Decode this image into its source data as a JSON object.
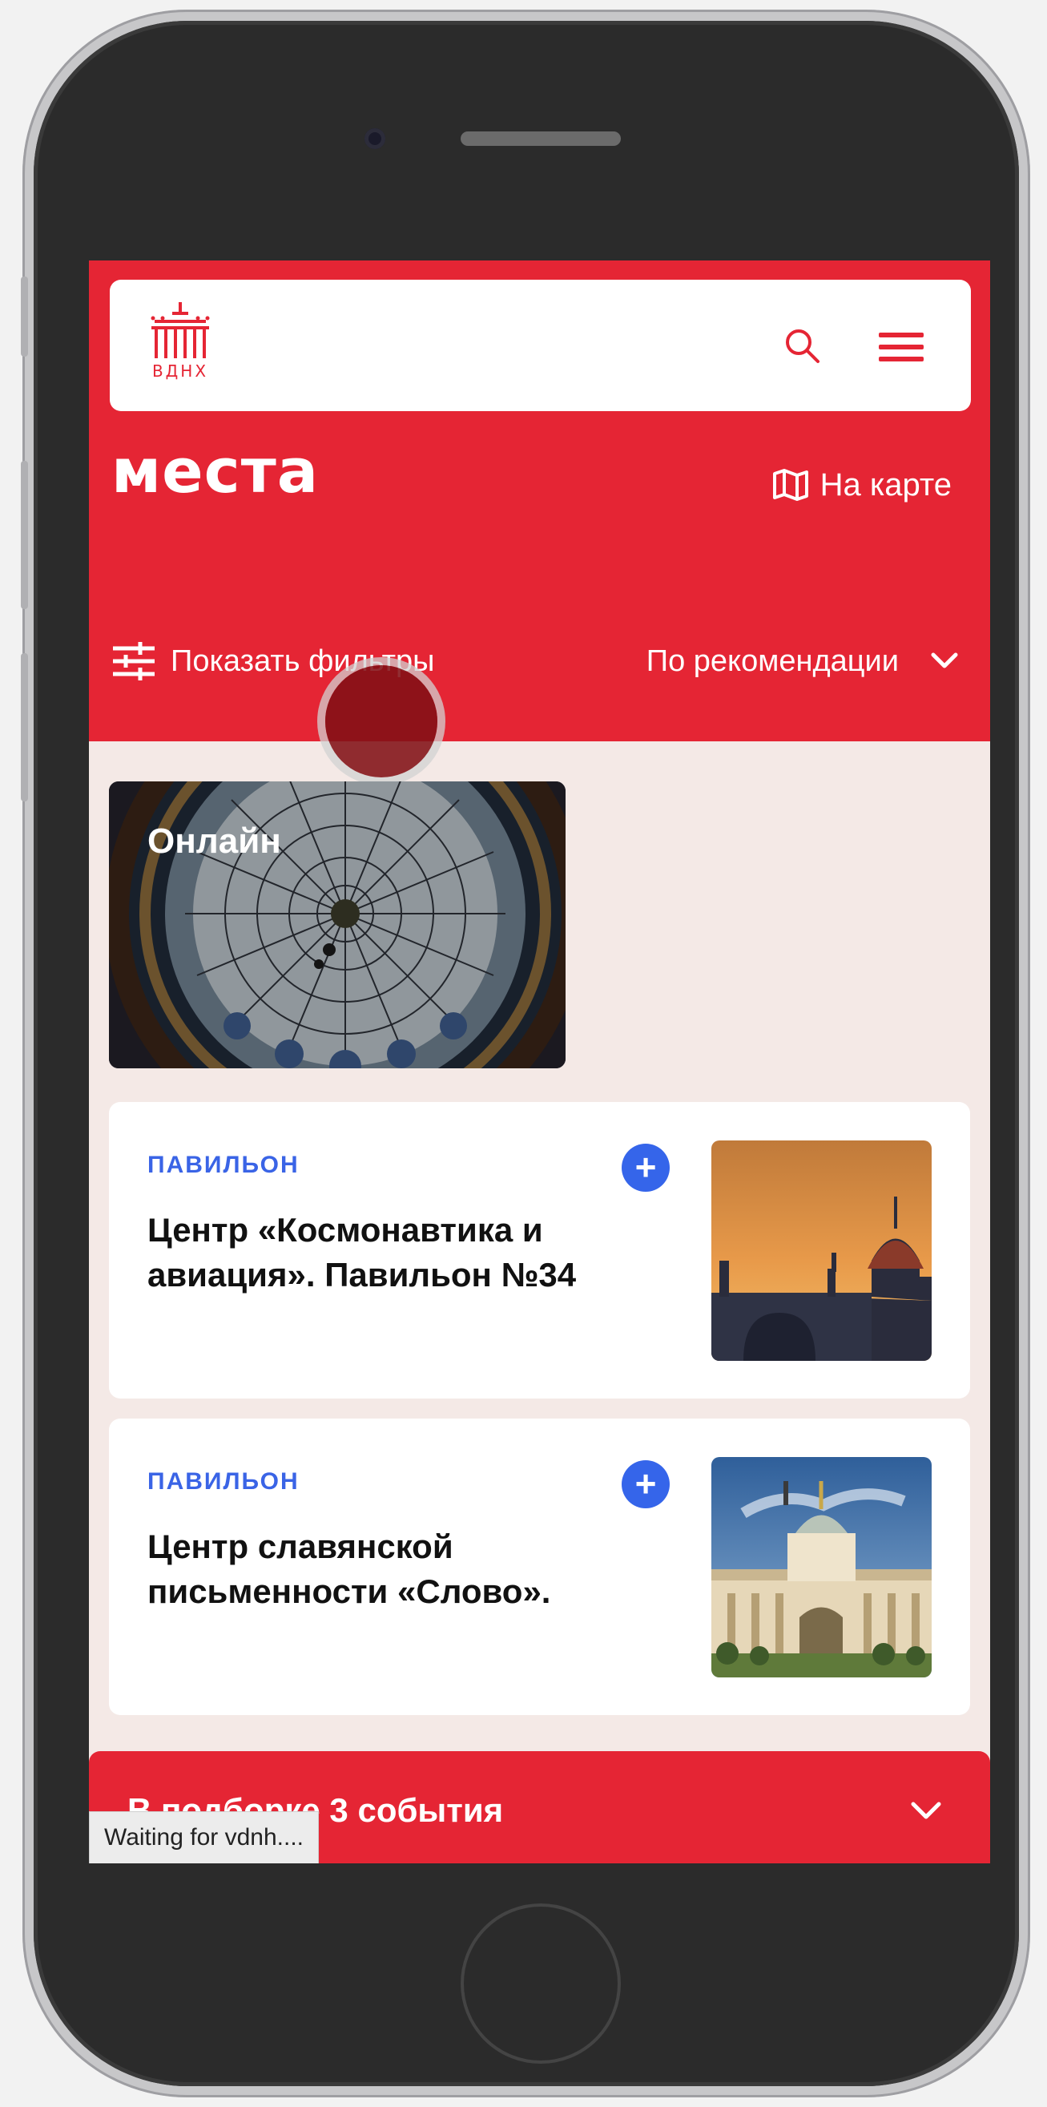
{
  "app": {
    "logo_text": "ВДНХ",
    "accent_color": "#e52534",
    "link_color": "#3a64e6"
  },
  "header": {
    "icons": [
      "search-icon",
      "hamburger-menu-icon"
    ]
  },
  "page": {
    "title": "места",
    "map_label": "На карте",
    "filters_label": "Показать фильтры",
    "sort_label": "По рекомендации"
  },
  "online_card": {
    "label": "Онлайн"
  },
  "places": [
    {
      "tag": "ПАВИЛЬОН",
      "title": "Центр «Космонавтика и авиация». Павильон №34"
    },
    {
      "tag": "ПАВИЛЬОН",
      "title": "Центр славянской письменности «Слово»."
    }
  ],
  "collection_bar": {
    "label": "В подборке 3 события"
  },
  "browser_status": "Waiting for vdnh...."
}
